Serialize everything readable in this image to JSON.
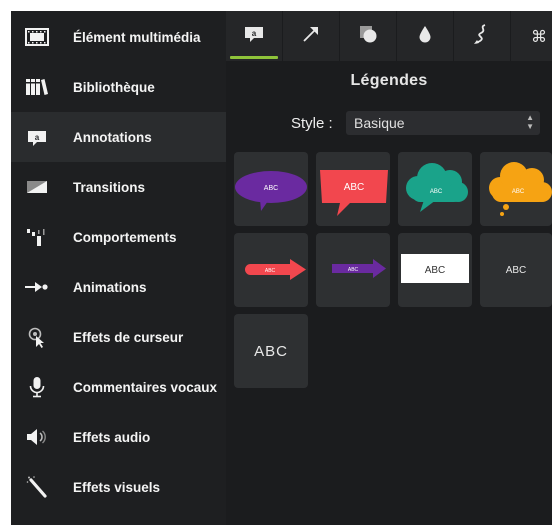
{
  "sidebar": {
    "items": [
      {
        "label": "Élément multimédia",
        "icon": "film-strip-icon"
      },
      {
        "label": "Bibliothèque",
        "icon": "library-books-icon"
      },
      {
        "label": "Annotations",
        "icon": "annotation-callout-icon"
      },
      {
        "label": "Transitions",
        "icon": "transition-icon"
      },
      {
        "label": "Comportements",
        "icon": "behaviors-icon"
      },
      {
        "label": "Animations",
        "icon": "animation-arrow-icon"
      },
      {
        "label": "Effets de curseur",
        "icon": "cursor-effect-icon"
      },
      {
        "label": "Commentaires vocaux",
        "icon": "microphone-icon"
      },
      {
        "label": "Effets audio",
        "icon": "speaker-icon"
      },
      {
        "label": "Effets visuels",
        "icon": "magic-wand-icon"
      }
    ],
    "active_index": 2
  },
  "tabs": [
    {
      "icon": "callout-tab-icon",
      "glyph": "a"
    },
    {
      "icon": "arrow-tab-icon"
    },
    {
      "icon": "shape-tab-icon"
    },
    {
      "icon": "blur-drop-tab-icon"
    },
    {
      "icon": "sketch-motion-tab-icon"
    },
    {
      "icon": "keystroke-tab-icon",
      "glyph": "⌘"
    }
  ],
  "panel": {
    "title": "Légendes",
    "style_label": "Style :",
    "style_value": "Basique"
  },
  "tiles": [
    {
      "kind": "speech-bubble",
      "text": "ABC",
      "color": "#6a2aa0"
    },
    {
      "kind": "square-callout",
      "text": "ABC",
      "color": "#f2474e"
    },
    {
      "kind": "cloud-callout",
      "text": "ABC",
      "color": "#1aa38a"
    },
    {
      "kind": "thought-cloud",
      "text": "ABC",
      "color": "#f6a313"
    },
    {
      "kind": "arrow-callout",
      "text": "ABC",
      "color": "#f2474e"
    },
    {
      "kind": "arrow-callout",
      "text": "ABC",
      "color": "#6a2aa0"
    },
    {
      "kind": "boxed-text",
      "text": "ABC",
      "color": "#ffffff"
    },
    {
      "kind": "plain-text",
      "text": "ABC",
      "color": "#ffffff"
    },
    {
      "kind": "plain-text-large",
      "text": "ABC",
      "color": "#ffffff"
    }
  ]
}
